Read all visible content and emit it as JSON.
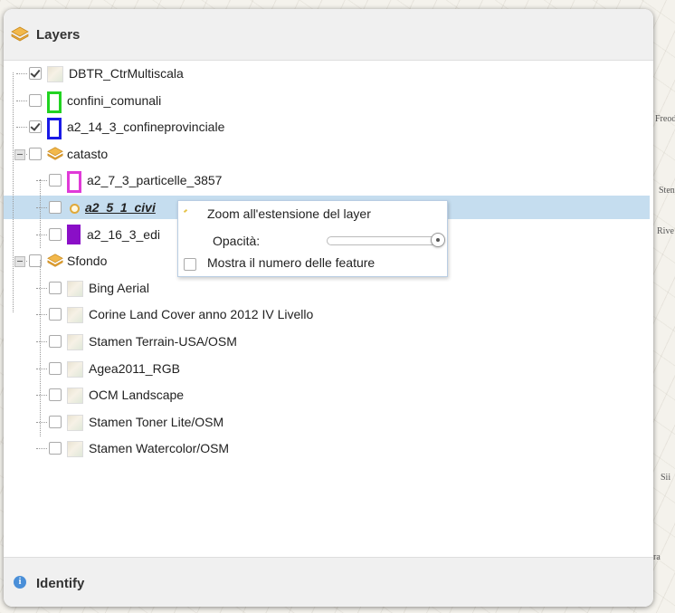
{
  "map": {
    "labels": [
      "Freod",
      "Rive",
      "Stent",
      "Sii",
      "ra"
    ]
  },
  "panel": {
    "title": "Layers",
    "footer_title": "Identify",
    "icons": {
      "header": "layers-stack-icon",
      "footer": "info-icon",
      "folder": "layers-stack-icon",
      "layer": "map-thumbnail-icon"
    },
    "colors": {
      "accent": "#c5ddef",
      "stack": "#e8a63a"
    }
  },
  "tree": [
    {
      "label": "DBTR_CtrMultiscala",
      "checked": true,
      "type": "thumb"
    },
    {
      "label": "confini_comunali",
      "checked": false,
      "type": "swatch",
      "color": "#22d322"
    },
    {
      "label": "a2_14_3_confineprovinciale",
      "checked": true,
      "type": "swatch",
      "color": "#1a1ae6"
    },
    {
      "label": "catasto",
      "checked": false,
      "type": "group"
    },
    {
      "label": "a2_7_3_particelle_3857",
      "checked": false,
      "type": "swatch",
      "color": "#e03ad8"
    },
    {
      "label": "a2_5_1_civi",
      "checked": false,
      "type": "dot",
      "selected": true
    },
    {
      "label": "a2_16_3_edi",
      "checked": false,
      "type": "filled",
      "color": "#8a0fc7"
    },
    {
      "label": "Sfondo",
      "checked": false,
      "type": "group"
    },
    {
      "label": "Bing Aerial",
      "checked": false,
      "type": "thumb"
    },
    {
      "label": "Corine Land Cover anno 2012 IV Livello",
      "checked": false,
      "type": "thumb"
    },
    {
      "label": "Stamen Terrain-USA/OSM",
      "checked": false,
      "type": "thumb"
    },
    {
      "label": "Agea2011_RGB",
      "checked": false,
      "type": "thumb"
    },
    {
      "label": "OCM Landscape",
      "checked": false,
      "type": "thumb"
    },
    {
      "label": "Stamen Toner Lite/OSM",
      "checked": false,
      "type": "thumb"
    },
    {
      "label": "Stamen Watercolor/OSM",
      "checked": false,
      "type": "thumb"
    }
  ],
  "context_menu": {
    "zoom_label": "Zoom all'estensione del layer",
    "opacity_label": "Opacità:",
    "opacity_value": 1.0,
    "feature_count_label": "Mostra il numero delle feature",
    "feature_count_checked": false
  }
}
